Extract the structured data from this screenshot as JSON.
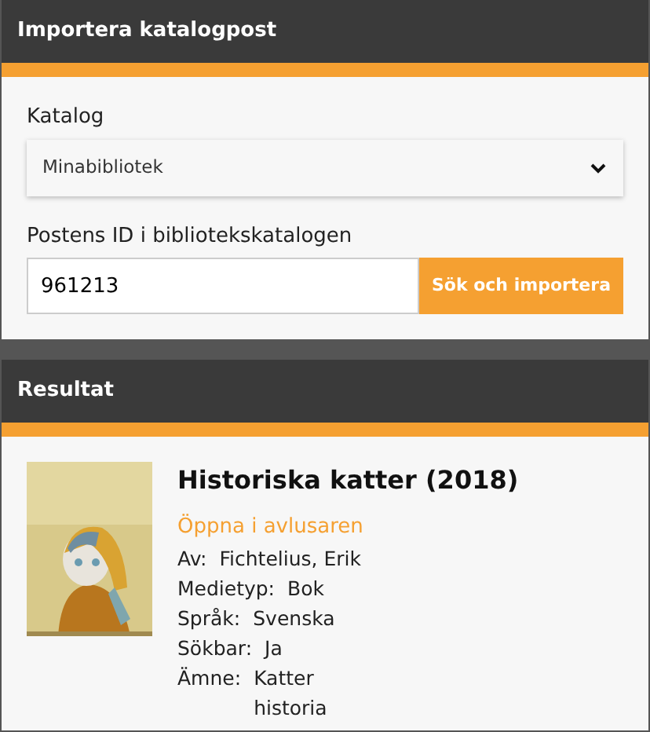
{
  "import_panel": {
    "title": "Importera katalogpost",
    "catalog": {
      "label": "Katalog",
      "value": "Minabibliotek"
    },
    "record_id": {
      "label": "Postens ID i bibliotekskatalogen",
      "value": "961213"
    },
    "button": "Sök och importera"
  },
  "result_panel": {
    "title": "Resultat",
    "book_title": "Historiska katter (2018)",
    "open_link": "Öppna i avlusaren",
    "fields": [
      {
        "label": "Av:",
        "values": [
          "Fichtelius, Erik"
        ]
      },
      {
        "label": "Medietyp:",
        "values": [
          "Bok"
        ]
      },
      {
        "label": "Språk:",
        "values": [
          "Svenska"
        ]
      },
      {
        "label": "Sökbar:",
        "values": [
          "Ja"
        ]
      },
      {
        "label": "Ämne:",
        "values": [
          "Katter",
          "historia"
        ]
      }
    ]
  }
}
